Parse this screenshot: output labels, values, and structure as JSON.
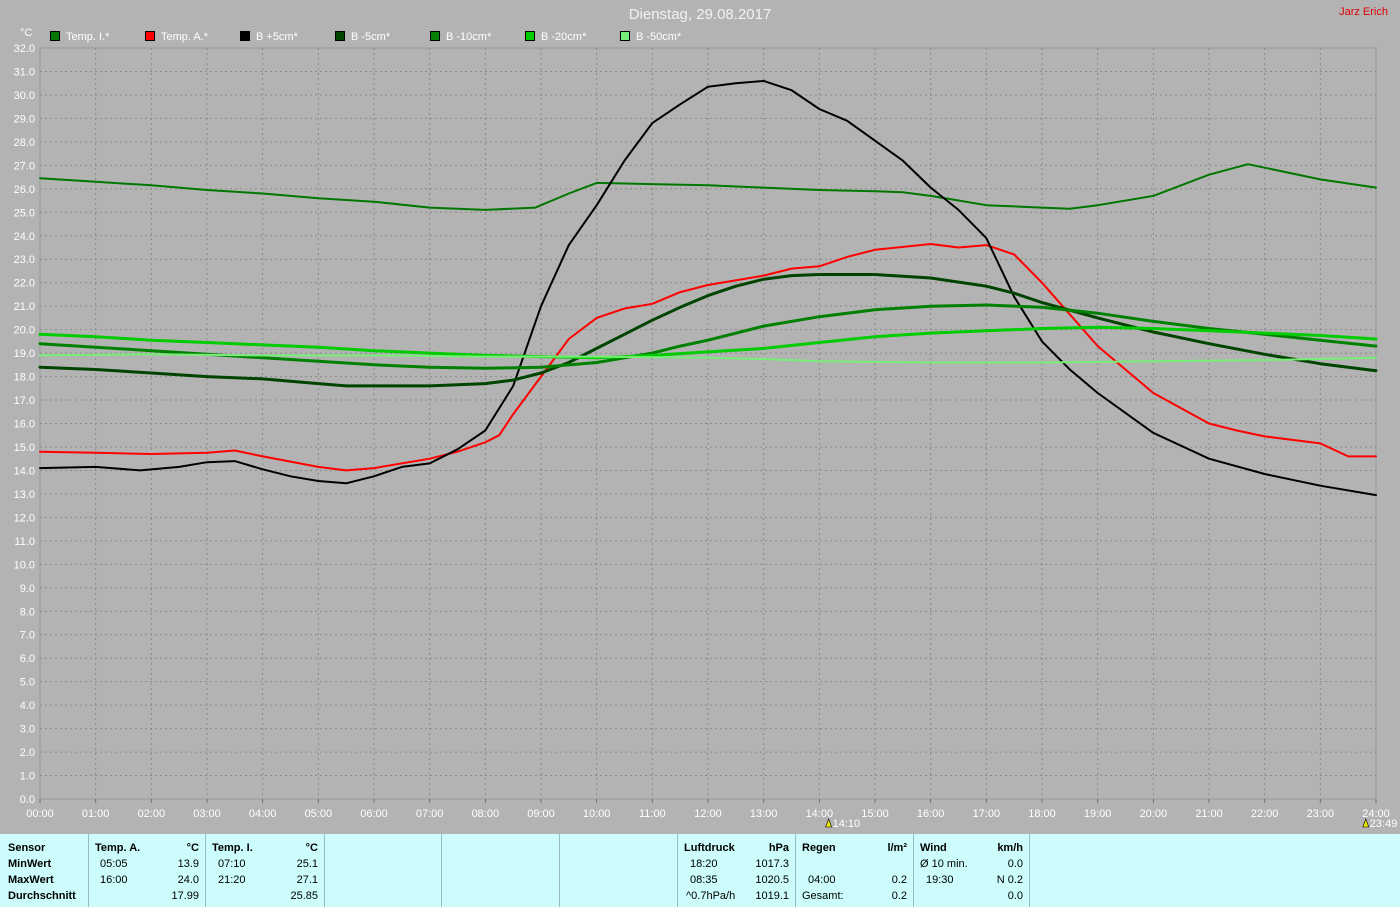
{
  "title": "Dienstag, 29.08.2017",
  "author": "Jarz Erich",
  "unit": "°C",
  "marker": {
    "label_bottom": "14:10",
    "label_end": "23:49"
  },
  "colors": {
    "grid": "#8a8a8a",
    "axis_text": "#ffffff",
    "panel": "#ccfcfc"
  },
  "chart_data": {
    "type": "line",
    "x_unit": "hours",
    "xlim": [
      0,
      24
    ],
    "ylim": [
      0,
      32
    ],
    "yticks": [
      "0.0",
      "1.0",
      "2.0",
      "3.0",
      "4.0",
      "5.0",
      "6.0",
      "7.0",
      "8.0",
      "9.0",
      "10.0",
      "11.0",
      "12.0",
      "13.0",
      "14.0",
      "15.0",
      "16.0",
      "17.0",
      "18.0",
      "19.0",
      "20.0",
      "21.0",
      "22.0",
      "23.0",
      "24.0",
      "25.0",
      "26.0",
      "27.0",
      "28.0",
      "29.0",
      "30.0",
      "31.0",
      "32.0"
    ],
    "xticks": [
      "00:00",
      "01:00",
      "02:00",
      "03:00",
      "04:00",
      "05:00",
      "06:00",
      "07:00",
      "08:00",
      "09:00",
      "10:00",
      "11:00",
      "12:00",
      "13:00",
      "14:00",
      "15:00",
      "16:00",
      "17:00",
      "18:00",
      "19:00",
      "20:00",
      "21:00",
      "22:00",
      "23:00",
      "24:00"
    ],
    "grid": true,
    "legend_position": "top-left",
    "series": [
      {
        "name": "Temp. I.*",
        "color": "#007700",
        "width": 2,
        "x": [
          0,
          1,
          2,
          3,
          4,
          5,
          6,
          7,
          8,
          8.9,
          9.5,
          10,
          11,
          12,
          13,
          14,
          15,
          15.5,
          16,
          16.5,
          17,
          18,
          18.5,
          19,
          20,
          21,
          21.7,
          22,
          23,
          24
        ],
        "y": [
          26.45,
          26.3,
          26.15,
          25.95,
          25.8,
          25.6,
          25.45,
          25.2,
          25.1,
          25.2,
          25.8,
          26.25,
          26.2,
          26.15,
          26.05,
          25.95,
          25.9,
          25.85,
          25.7,
          25.5,
          25.3,
          25.2,
          25.15,
          25.3,
          25.7,
          26.6,
          27.05,
          26.9,
          26.4,
          26.05
        ]
      },
      {
        "name": "Temp. A.*",
        "color": "#ff0000",
        "width": 2,
        "x": [
          0,
          1,
          2,
          3,
          3.5,
          4,
          5,
          5.5,
          6,
          7,
          7.5,
          8,
          8.25,
          8.5,
          9,
          9.5,
          10,
          10.5,
          11,
          11.5,
          12,
          13,
          13.5,
          14,
          14.5,
          15,
          16,
          16.5,
          17,
          17.5,
          18,
          19,
          20,
          21,
          21.5,
          22,
          23,
          23.5,
          24
        ],
        "y": [
          14.8,
          14.75,
          14.7,
          14.75,
          14.85,
          14.6,
          14.15,
          14.0,
          14.1,
          14.5,
          14.8,
          15.2,
          15.5,
          16.4,
          18.0,
          19.6,
          20.5,
          20.9,
          21.1,
          21.6,
          21.9,
          22.3,
          22.6,
          22.7,
          23.1,
          23.4,
          23.65,
          23.5,
          23.6,
          23.2,
          22.0,
          19.3,
          17.3,
          16.0,
          15.7,
          15.45,
          15.15,
          14.6,
          14.6
        ]
      },
      {
        "name": "B +5cm*",
        "color": "#000000",
        "width": 2,
        "x": [
          0,
          1,
          1.8,
          2.5,
          3,
          3.5,
          4,
          4.5,
          5,
          5.5,
          6,
          6.5,
          7,
          7.5,
          8,
          8.5,
          9,
          9.5,
          10,
          10.5,
          11,
          11.5,
          12,
          12.5,
          13,
          13.5,
          14,
          14.5,
          15,
          15.5,
          16,
          16.5,
          17,
          17.5,
          18,
          18.5,
          19,
          20,
          21,
          22,
          23,
          24
        ],
        "y": [
          14.1,
          14.15,
          14.0,
          14.15,
          14.35,
          14.4,
          14.05,
          13.75,
          13.55,
          13.45,
          13.75,
          14.15,
          14.3,
          14.9,
          15.7,
          17.6,
          21.0,
          23.6,
          25.3,
          27.2,
          28.8,
          29.6,
          30.35,
          30.5,
          30.6,
          30.2,
          29.4,
          28.9,
          28.05,
          27.2,
          26.05,
          25.1,
          23.9,
          21.4,
          19.5,
          18.3,
          17.3,
          15.6,
          14.5,
          13.85,
          13.35,
          12.95
        ]
      },
      {
        "name": "B -5cm*",
        "color": "#004400",
        "width": 3,
        "x": [
          0,
          1,
          2,
          3,
          4,
          5,
          5.5,
          6,
          7,
          8,
          8.5,
          9,
          9.5,
          10,
          10.5,
          11,
          11.5,
          12,
          12.5,
          13,
          13.5,
          14,
          15,
          16,
          17,
          17.5,
          18,
          19,
          20,
          21,
          22,
          23,
          24
        ],
        "y": [
          18.4,
          18.3,
          18.15,
          18.0,
          17.9,
          17.7,
          17.6,
          17.6,
          17.6,
          17.7,
          17.85,
          18.15,
          18.6,
          19.2,
          19.8,
          20.4,
          20.95,
          21.45,
          21.85,
          22.15,
          22.3,
          22.35,
          22.35,
          22.2,
          21.85,
          21.55,
          21.15,
          20.5,
          19.9,
          19.4,
          18.95,
          18.55,
          18.25
        ]
      },
      {
        "name": "B -10cm*",
        "color": "#008000",
        "width": 3,
        "x": [
          0,
          1,
          2,
          3,
          4,
          5,
          6,
          7,
          8,
          9,
          10,
          11,
          11.5,
          12,
          13,
          14,
          15,
          16,
          17,
          18,
          19,
          20,
          21,
          22,
          23,
          24
        ],
        "y": [
          19.4,
          19.25,
          19.1,
          18.95,
          18.8,
          18.65,
          18.5,
          18.4,
          18.35,
          18.4,
          18.6,
          19.0,
          19.3,
          19.55,
          20.15,
          20.55,
          20.85,
          21.0,
          21.05,
          20.95,
          20.7,
          20.35,
          20.05,
          19.8,
          19.55,
          19.3
        ]
      },
      {
        "name": "B -20cm*",
        "color": "#00cc00",
        "width": 3,
        "x": [
          0,
          1,
          2,
          3,
          4,
          5,
          6,
          7,
          8,
          9,
          10,
          11,
          12,
          13,
          14,
          15,
          16,
          17,
          18,
          19,
          20,
          21,
          22,
          23,
          24
        ],
        "y": [
          19.8,
          19.7,
          19.55,
          19.45,
          19.35,
          19.25,
          19.1,
          19.0,
          18.9,
          18.85,
          18.8,
          18.9,
          19.05,
          19.2,
          19.45,
          19.7,
          19.85,
          19.95,
          20.05,
          20.1,
          20.05,
          19.95,
          19.85,
          19.75,
          19.6
        ]
      },
      {
        "name": "B -50cm*",
        "color": "#77ee77",
        "width": 2,
        "x": [
          0,
          2,
          4,
          6,
          8,
          10,
          12,
          13,
          14,
          16,
          18,
          20,
          22,
          24
        ],
        "y": [
          18.9,
          18.95,
          18.9,
          18.9,
          18.85,
          18.85,
          18.8,
          18.75,
          18.65,
          18.6,
          18.6,
          18.65,
          18.7,
          18.8
        ]
      }
    ]
  },
  "stats": {
    "col_sensor": {
      "header": "Sensor",
      "min": "MinWert",
      "max": "MaxWert",
      "avg": "Durchschnitt"
    },
    "col_temp_a": {
      "header": "Temp. A.",
      "unit": "°C",
      "min_time": "05:05",
      "min_val": "13.9",
      "max_time": "16:00",
      "max_val": "24.0",
      "avg_val": "17.99"
    },
    "col_temp_i": {
      "header": "Temp. I.",
      "unit": "°C",
      "min_time": "07:10",
      "min_val": "25.1",
      "max_time": "21:20",
      "max_val": "27.1",
      "avg_val": "25.85"
    },
    "col_press": {
      "header": "Luftdruck",
      "unit": "hPa",
      "min_time": "18:20",
      "min_val": "1017.3",
      "max_time": "08:35",
      "max_val": "1020.5",
      "trend_label": "^0.7hPa/h",
      "trend_val": "1019.1"
    },
    "col_rain": {
      "header": "Regen",
      "unit": "l/m²",
      "max_time": "04:00",
      "max_val": "0.2",
      "total_label": "Gesamt:",
      "total_val": "0.2"
    },
    "col_wind": {
      "header": "Wind",
      "unit": "km/h",
      "min_label": "Ø 10 min.",
      "min_val": "0.0",
      "max_time": "19:30",
      "max_val": "N 0.2",
      "avg_val": "0.0"
    }
  }
}
